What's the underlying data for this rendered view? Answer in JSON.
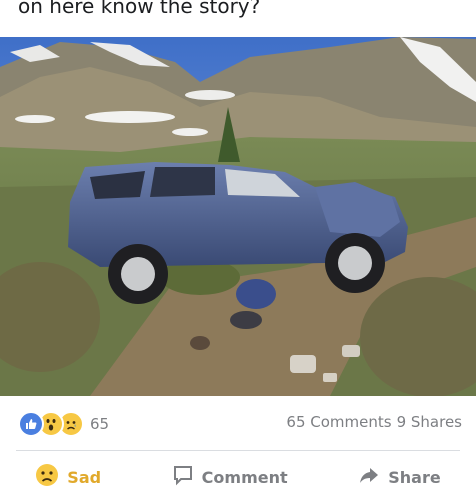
{
  "post": {
    "text": "on here know the story?"
  },
  "photo": {
    "description_icon": "photo-image"
  },
  "reactions": {
    "icons": [
      "like-icon",
      "wow-icon",
      "sad-icon"
    ],
    "count": "65",
    "comments": "65 Comments",
    "shares": "9 Shares"
  },
  "actions": {
    "react": "Sad",
    "comment": "Comment",
    "share": "Share"
  },
  "colors": {
    "like_blue": "#4a7fe0",
    "reaction_yellow": "#f7c844",
    "sad_label": "#e1a92b",
    "muted_text": "#7d7f83"
  }
}
